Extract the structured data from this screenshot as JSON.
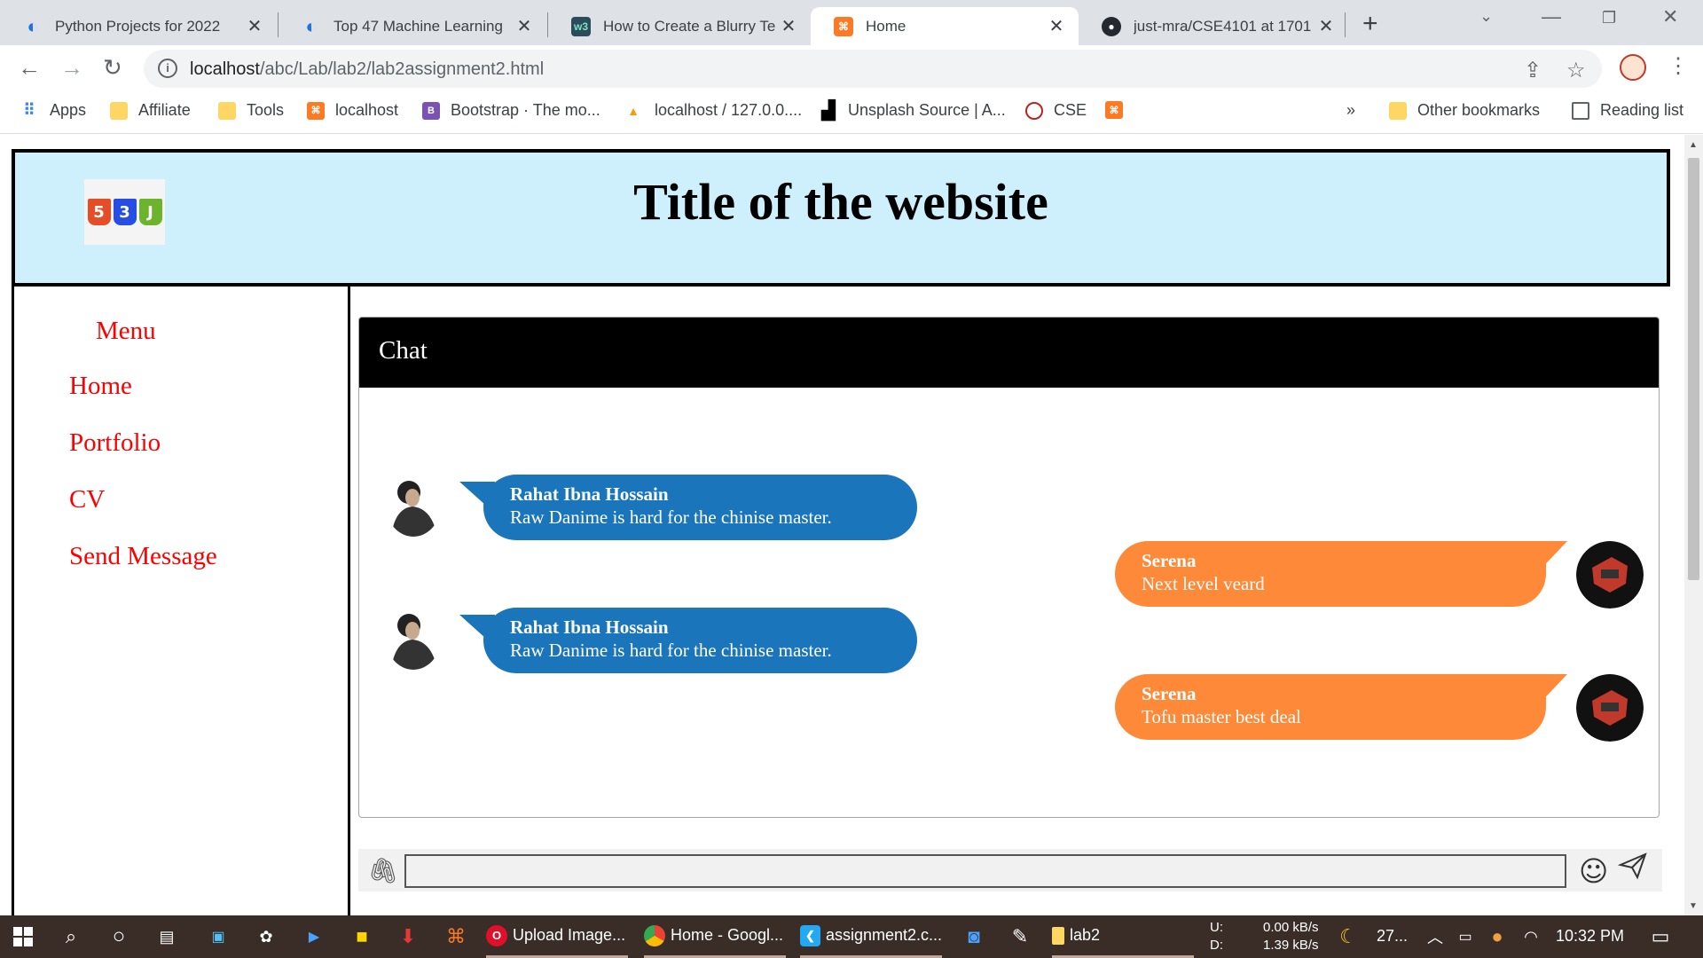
{
  "browser": {
    "tabs": [
      {
        "title": "Python Projects for 2022",
        "icon": "python-projects-icon",
        "color": "#1a73e8",
        "glyph": "◐"
      },
      {
        "title": "Top 47 Machine Learning",
        "icon": "python-projects-icon",
        "color": "#1a73e8",
        "glyph": "◐"
      },
      {
        "title": "How to Create a Blurry Te",
        "icon": "w3-icon",
        "color": "#2b4c5a",
        "glyph": "w3"
      },
      {
        "title": "Home",
        "icon": "xampp-icon",
        "color": "#fb7a24",
        "glyph": "⌘",
        "active": true
      },
      {
        "title": "just-mra/CSE4101 at 1701",
        "icon": "github-icon",
        "color": "#24292f",
        "glyph": "●"
      }
    ],
    "url_host": "localhost",
    "url_path": "/abc/Lab/lab2/lab2assignment2.html",
    "bookmarks": [
      {
        "label": "Apps",
        "icon": "apps-grid-icon"
      },
      {
        "label": "Affiliate",
        "icon": "folder-icon"
      },
      {
        "label": "Tools",
        "icon": "folder-icon"
      },
      {
        "label": "localhost",
        "icon": "xampp-icon"
      },
      {
        "label": "Bootstrap · The mo...",
        "icon": "bootstrap-icon"
      },
      {
        "label": "localhost / 127.0.0....",
        "icon": "phpmyadmin-icon"
      },
      {
        "label": "Unsplash Source | A...",
        "icon": "unsplash-icon"
      },
      {
        "label": "CSE",
        "icon": "cse-icon"
      },
      {
        "label": "",
        "icon": "xampp-icon"
      }
    ],
    "bookmarks_overflow": "»",
    "other_bookmarks": "Other bookmarks",
    "reading_list": "Reading list"
  },
  "page": {
    "title": "Title of the website",
    "logo_letters": [
      "5",
      "3",
      "J"
    ],
    "logo_colors": [
      "#e44d26",
      "#264de4",
      "#6cb42c"
    ],
    "menu": {
      "title": "Menu",
      "items": [
        "Home",
        "Portfolio",
        "CV",
        "Send Message"
      ]
    },
    "chat": {
      "title": "Chat",
      "messages": [
        {
          "side": "left",
          "name": "Rahat Ibna Hossain",
          "text": "Raw Danime is hard for the chinise master."
        },
        {
          "side": "right",
          "name": "Serena",
          "text": "Next level veard"
        },
        {
          "side": "left",
          "name": "Rahat Ibna Hossain",
          "text": "Raw Danime is hard for the chinise master."
        },
        {
          "side": "right",
          "name": "Serena",
          "text": "Tofu master best deal"
        }
      ],
      "input_value": "",
      "colors": {
        "left": "#1b75bb",
        "right": "#fe8a39"
      }
    }
  },
  "taskbar": {
    "apps": [
      {
        "label": "Upload Image...",
        "icon": "opera-icon"
      },
      {
        "label": "Home - Googl...",
        "icon": "chrome-icon"
      },
      {
        "label": "assignment2.c...",
        "icon": "vscode-icon"
      },
      {
        "label": "lab2",
        "icon": "file-explorer-icon"
      }
    ],
    "net_u_label": "U:",
    "net_d_label": "D:",
    "net_up": "0.00 kB/s",
    "net_down": "1.39 kB/s",
    "weather": "27...",
    "time": "10:32 PM"
  }
}
